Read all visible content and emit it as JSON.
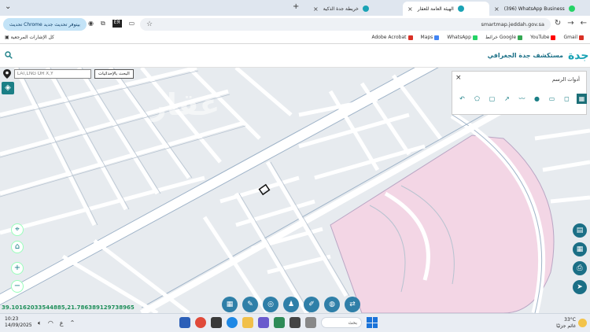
{
  "browser": {
    "tabs": [
      {
        "title": "(396) WhatsApp Business",
        "fav_color": "#25d366"
      },
      {
        "title": "الهيئة العامة للعقار",
        "fav_color": "#1aa3b5"
      },
      {
        "title": "خريطة جدة الذكية",
        "fav_color": "#1aa3b5"
      }
    ],
    "update_button": "تحديث Chrome بيتوفر تحديث جديد",
    "url": "smartmap.jeddah.gov.sa",
    "bookmarks_all": "كل الإشارات المرجعية",
    "bookmarks": [
      "Gmail",
      "YouTube",
      "خرائط Google",
      "WhatsApp",
      "Maps",
      "Adobe Acrobat"
    ],
    "bookmark_colors": [
      "#d93025",
      "#ff0000",
      "#34a853",
      "#25d366",
      "#4285f4",
      "#d93025"
    ]
  },
  "map_header": {
    "title": "مستكشف جدة الجغرافي",
    "logo_text": "جدة"
  },
  "coord_bar": {
    "placeholder": "LAT,LNG OR X,Y",
    "button": "البحث بالإحداثيات"
  },
  "draw_panel": {
    "title": "أدوات الرسم",
    "tools": [
      "↶",
      "⬠",
      "▢",
      "↗",
      "〰",
      "●",
      "▭",
      "◻",
      "▦"
    ]
  },
  "map": {
    "coords_readout": "39.10162033544885,21.786389129738965"
  },
  "taskbar": {
    "time": "10:23",
    "date": "14/09/2025",
    "search_label": "بحث",
    "weather_temp": "33°C",
    "weather_desc": "غائم جزئيًا"
  },
  "colors": {
    "accent": "#1b7f86",
    "park_pink": "#f4d7e6",
    "road_blue": "#8aa8c3"
  }
}
